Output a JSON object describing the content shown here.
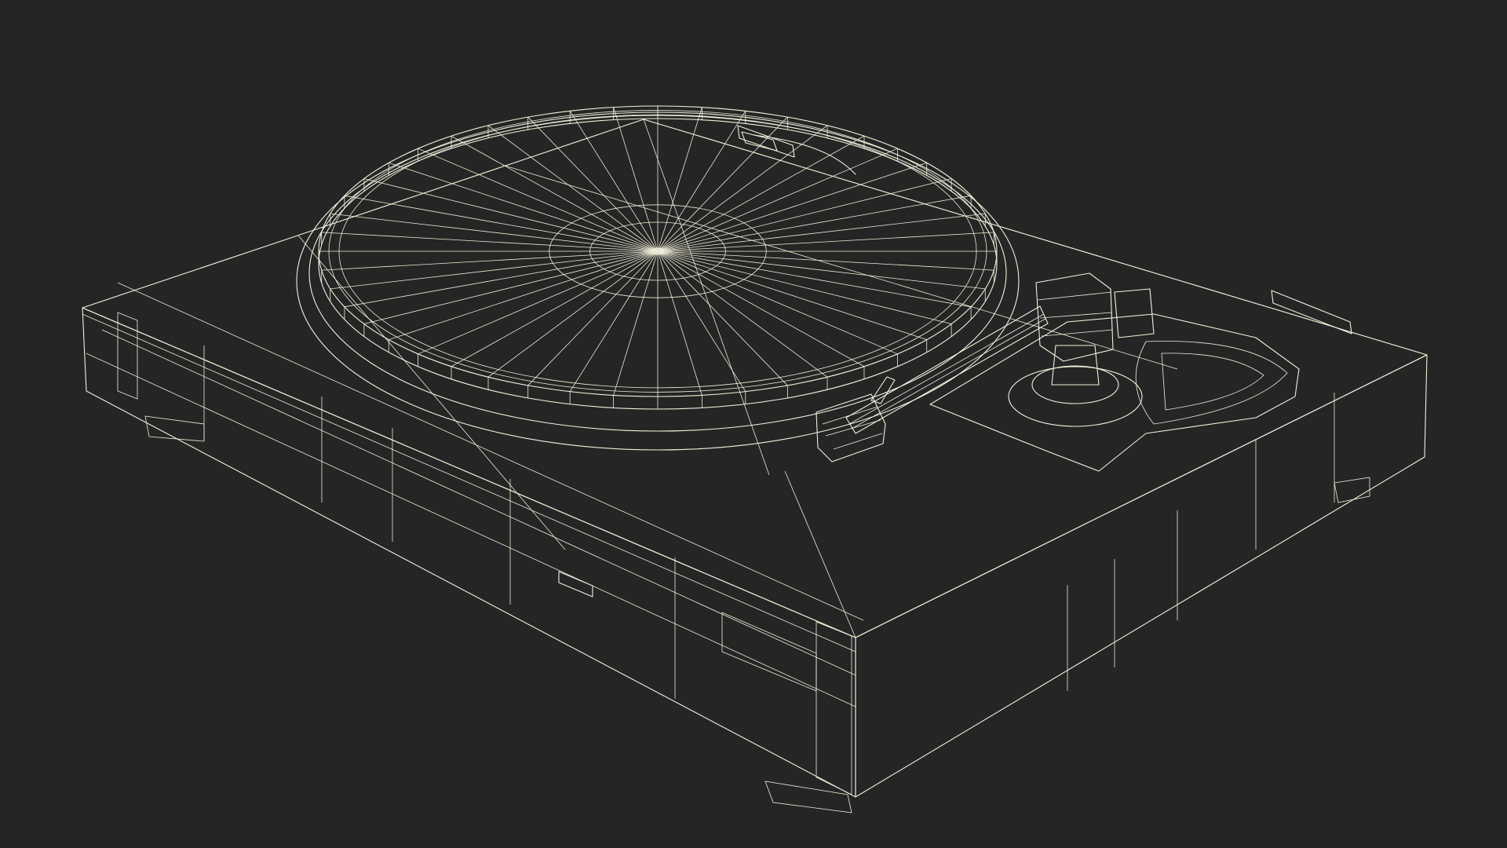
{
  "scene": {
    "subject": "turntable-wireframe-render",
    "background_color": "#252525",
    "surface_top_color": "#7d7f70",
    "surface_front_color": "#6e705f",
    "surface_side_color": "#77796a",
    "wire_color": "#f2f0dc",
    "platter_spokes": 48,
    "platter_rings": 4
  }
}
